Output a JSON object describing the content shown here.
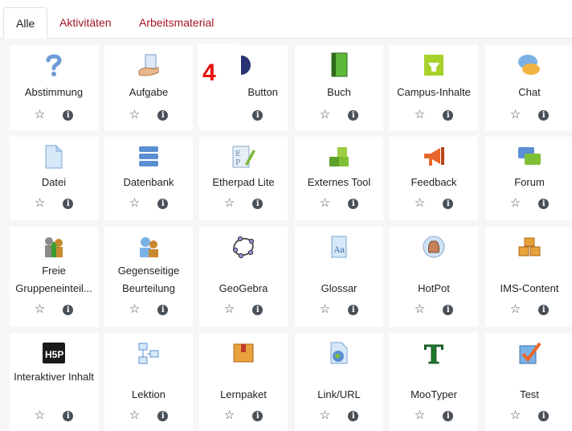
{
  "tabs": [
    {
      "label": "Alle",
      "active": true
    },
    {
      "label": "Aktivitäten",
      "active": false
    },
    {
      "label": "Arbeitsmaterial",
      "active": false
    }
  ],
  "overlay_number": "4",
  "rows": [
    [
      {
        "label": "Abstimmung",
        "icon": "question-icon"
      },
      {
        "label": "Aufgabe",
        "icon": "assignment-hand-icon"
      },
      {
        "label": "Button",
        "icon": "bigbluebutton-icon"
      },
      {
        "label": "Buch",
        "icon": "book-icon"
      },
      {
        "label": "Campus-Inhalte",
        "icon": "campus-icon"
      },
      {
        "label": "Chat",
        "icon": "chat-bubbles-icon"
      }
    ],
    [
      {
        "label": "Datei",
        "icon": "file-icon"
      },
      {
        "label": "Datenbank",
        "icon": "database-icon"
      },
      {
        "label": "Etherpad Lite",
        "icon": "etherpad-icon"
      },
      {
        "label": "Externes Tool",
        "icon": "puzzle-icon"
      },
      {
        "label": "Feedback",
        "icon": "megaphone-icon"
      },
      {
        "label": "Forum",
        "icon": "forum-icon"
      }
    ],
    [
      {
        "label": "Freie Gruppeneinteil...",
        "icon": "group-choice-icon"
      },
      {
        "label": "Gegenseitige Beurteilung",
        "icon": "workshop-icon"
      },
      {
        "label": "GeoGebra",
        "icon": "geogebra-icon"
      },
      {
        "label": "Glossar",
        "icon": "glossary-icon"
      },
      {
        "label": "HotPot",
        "icon": "hotpot-icon"
      },
      {
        "label": "IMS-Content",
        "icon": "ims-boxes-icon"
      }
    ],
    [
      {
        "label": "Interaktiver Inhalt",
        "icon": "h5p-icon"
      },
      {
        "label": "Lektion",
        "icon": "lesson-icon"
      },
      {
        "label": "Lernpaket",
        "icon": "scorm-package-icon"
      },
      {
        "label": "Link/URL",
        "icon": "url-globe-icon"
      },
      {
        "label": "MooTyper",
        "icon": "mootyper-icon"
      },
      {
        "label": "Test",
        "icon": "quiz-check-icon"
      }
    ]
  ],
  "colors": {
    "accent": "#a31628",
    "text": "#1d2125",
    "grid_bg": "#f6f6f6",
    "icon_grey": "#495057",
    "badge_red": "#e8120f"
  }
}
